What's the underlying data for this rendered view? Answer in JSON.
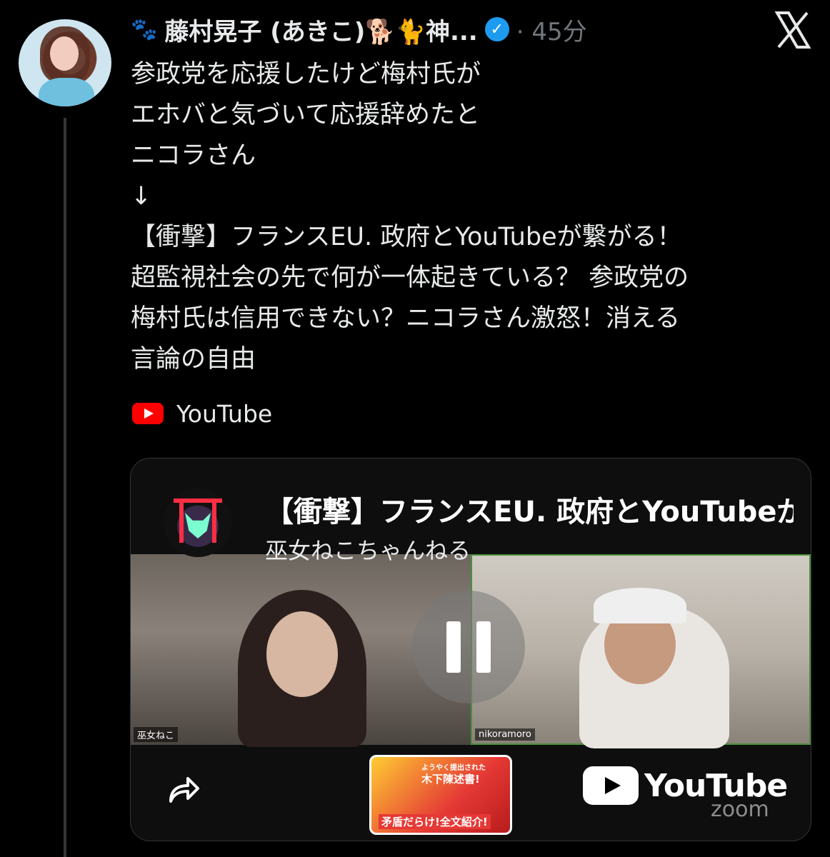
{
  "tweet": {
    "display_name": "藤村晃子 (あきこ)🐕🐈神...",
    "paw_icon": "🐾",
    "time": "· 45分",
    "text_lines": [
      "参政党を応援したけど梅村氏が",
      "エホバと気づいて応援辞めたと",
      "ニコラさん",
      "↓",
      "【衝撃】フランスEU. 政府とYouTubeが繋がる！",
      "超監視社会の先で何が一体起きている？ 参政党の",
      "梅村氏は信用できない？ニコラさん激怒！消える",
      "言論の自由"
    ],
    "source_label": "YouTube"
  },
  "card": {
    "title": "【衝撃】フランスEU. 政府とYouTubeが繋がる！",
    "channel": "巫女ねこちゃんねる",
    "left_tag": "巫女ねこ",
    "right_tag": "nikoramoro",
    "thumbnail_line1": "ようやく提出された",
    "thumbnail_line2": "木下陳述書!",
    "thumbnail_line3": "矛盾だらけ!全文紹介!",
    "yt_wordmark": "YouTube",
    "zoom_watermark": "zoom"
  },
  "colors": {
    "accent": "#1d9bf0",
    "youtube_red": "#ff0000",
    "bg": "#000000"
  }
}
